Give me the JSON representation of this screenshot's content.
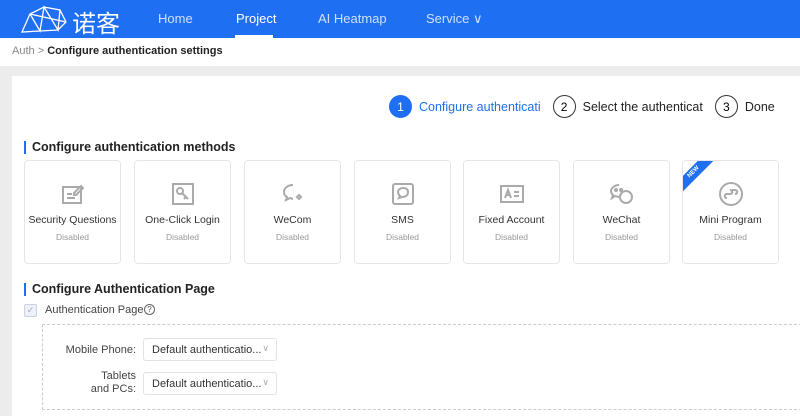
{
  "nav": {
    "brand": "诺客",
    "items": [
      {
        "label": "Home"
      },
      {
        "label": "Project",
        "active": true
      },
      {
        "label": "AI Heatmap"
      },
      {
        "label": "Service ∨"
      }
    ],
    "accent": "#1f6ff2"
  },
  "breadcrumb": {
    "parent": "Auth",
    "separator": " > ",
    "current": "Configure authentication settings"
  },
  "steps": [
    {
      "num": "1",
      "label": "Configure authenticati"
    },
    {
      "num": "2",
      "label": "Select the authenticat"
    },
    {
      "num": "3",
      "label": "Done"
    }
  ],
  "methods": {
    "title": "Configure authentication methods",
    "cards": [
      {
        "name": "Security Questions",
        "status": "Disabled",
        "icon": "edit-form-icon"
      },
      {
        "name": "One-Click Login",
        "status": "Disabled",
        "icon": "key-icon"
      },
      {
        "name": "WeCom",
        "status": "Disabled",
        "icon": "wecom-icon"
      },
      {
        "name": "SMS",
        "status": "Disabled",
        "icon": "sms-icon"
      },
      {
        "name": "Fixed Account",
        "status": "Disabled",
        "icon": "id-card-icon"
      },
      {
        "name": "WeChat",
        "status": "Disabled",
        "icon": "wechat-icon"
      },
      {
        "name": "Mini Program",
        "status": "Disabled",
        "icon": "mini-program-icon",
        "badge": "NEW"
      }
    ]
  },
  "auth_page": {
    "title": "Configure Authentication Page",
    "checkbox_label": "Authentication Page",
    "checked": true,
    "fields": [
      {
        "label": "Mobile Phone:",
        "value": "Default authenticatio..."
      },
      {
        "label": "Tablets and PCs:",
        "value": "Default authenticatio..."
      }
    ]
  }
}
